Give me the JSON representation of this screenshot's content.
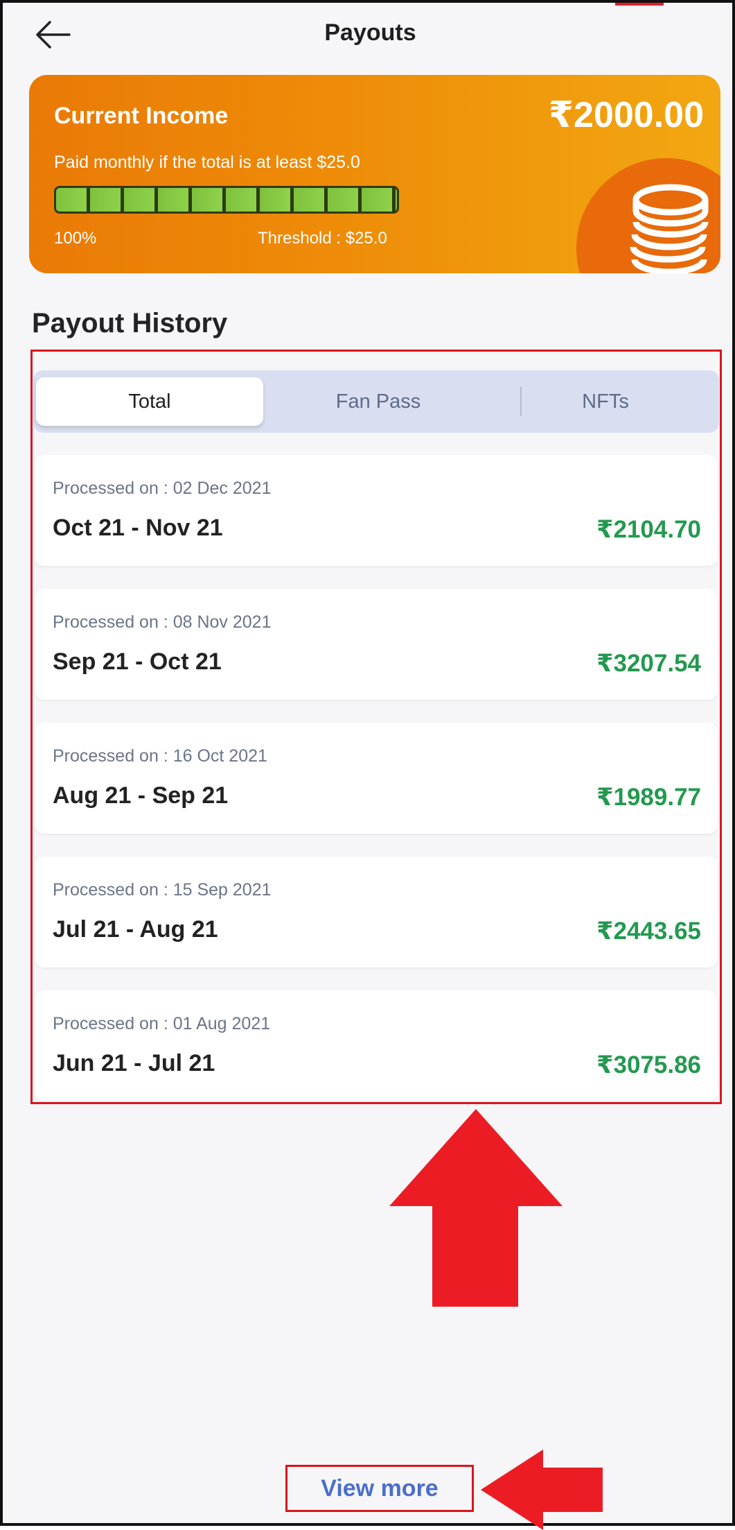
{
  "header": {
    "title": "Payouts",
    "back_icon": "arrow-left-icon"
  },
  "income_card": {
    "title": "Current Income",
    "amount": "₹2000.00",
    "subtitle": "Paid monthly if the total is at least $25.0",
    "progress_value": 1.0,
    "progress_percent_label": "100%",
    "threshold_label": "Threshold : $25.0",
    "icon": "coin-stack-icon",
    "colors": {
      "gradient_start": "#ea7a06",
      "gradient_end": "#f2a712"
    }
  },
  "history": {
    "title": "Payout History",
    "tabs": [
      {
        "label": "Total",
        "active": true
      },
      {
        "label": "Fan Pass",
        "active": false
      },
      {
        "label": "NFTs",
        "active": false
      }
    ],
    "items": [
      {
        "processed": "Processed on : 02 Dec 2021",
        "period": "Oct 21 - Nov 21",
        "amount": "₹2104.70"
      },
      {
        "processed": "Processed on : 08 Nov 2021",
        "period": "Sep 21 - Oct 21",
        "amount": "₹3207.54"
      },
      {
        "processed": "Processed on : 16 Oct 2021",
        "period": "Aug 21 - Sep 21",
        "amount": "₹1989.77"
      },
      {
        "processed": "Processed on : 15 Sep 2021",
        "period": "Jul 21 - Aug 21",
        "amount": "₹2443.65"
      },
      {
        "processed": "Processed on : 01 Aug 2021",
        "period": "Jun 21 - Jul 21",
        "amount": "₹3075.86"
      }
    ],
    "amount_color": "#23994f"
  },
  "footer": {
    "view_more_label": "View more"
  },
  "annotations": {
    "highlight_color": "#d9141e",
    "up_arrow_icon": "arrow-up-icon",
    "left_arrow_icon": "arrow-left-pointer-icon"
  }
}
